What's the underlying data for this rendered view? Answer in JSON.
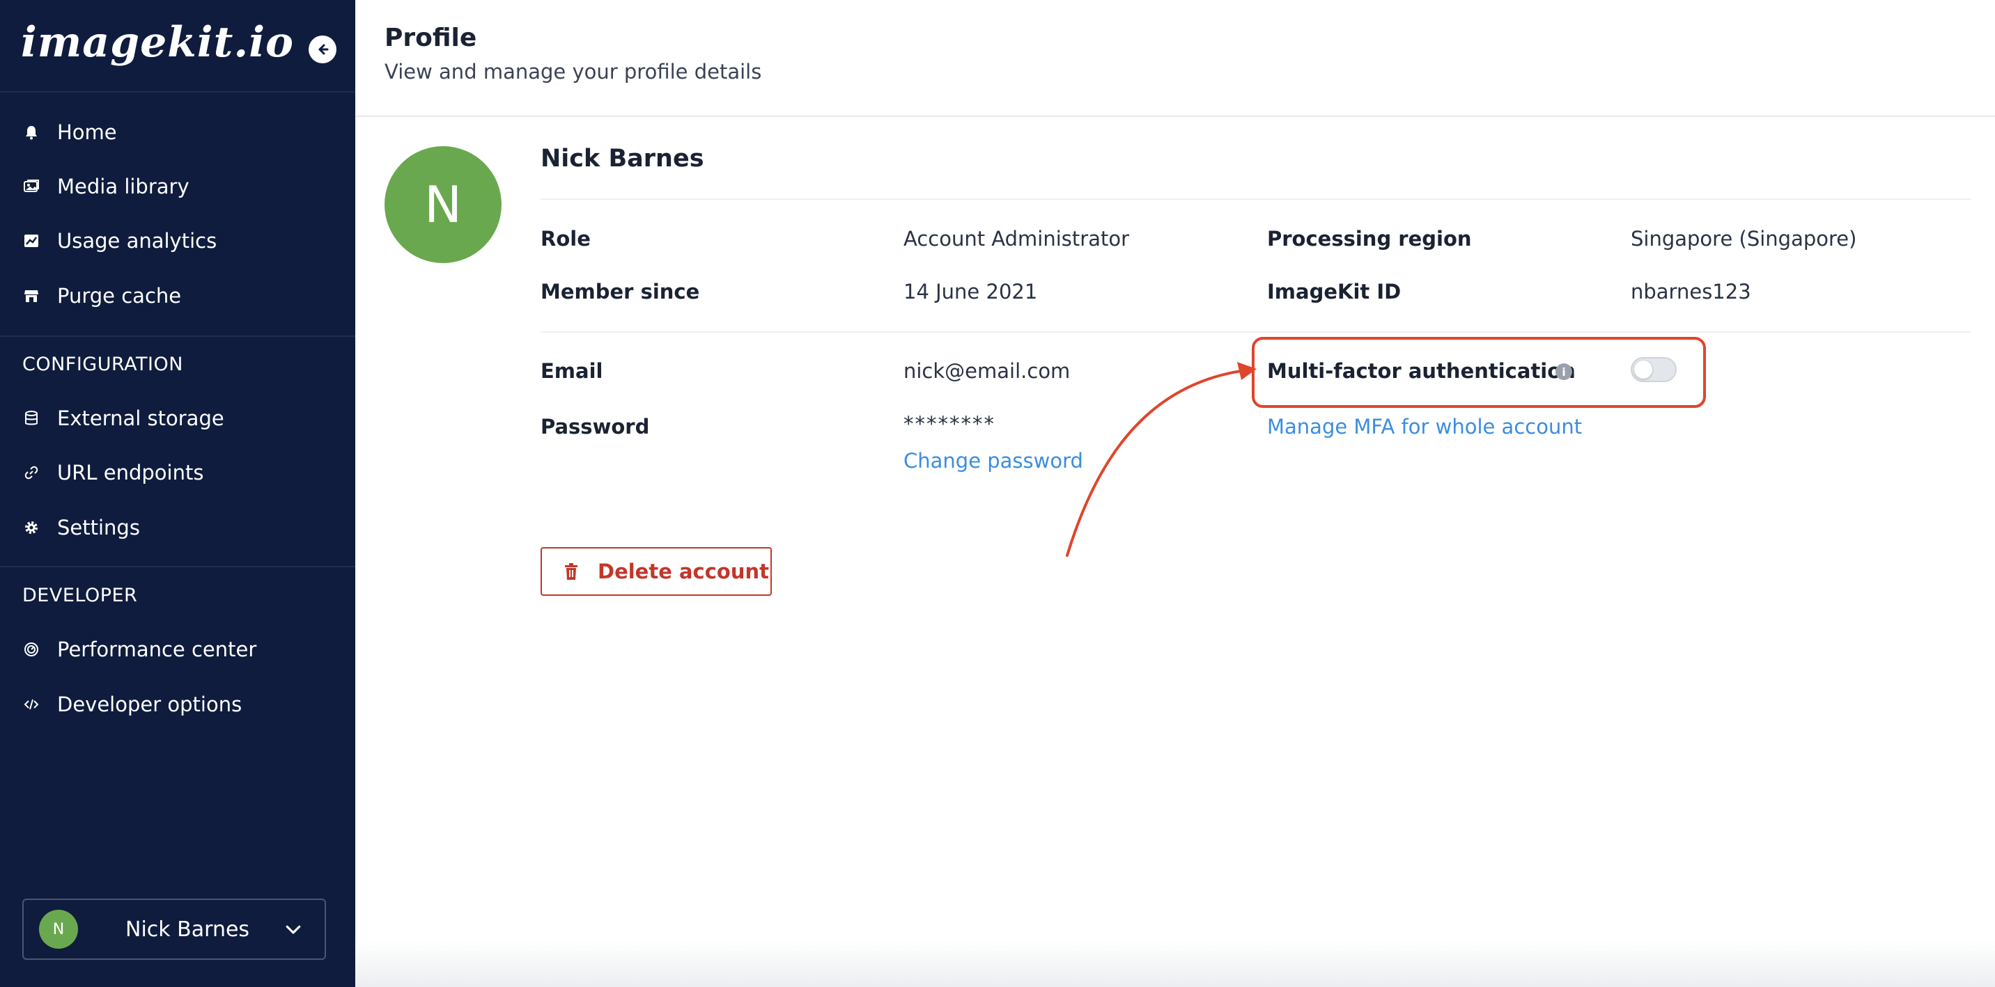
{
  "brand": {
    "logo_text": "imagekit.io"
  },
  "sidebar": {
    "items": [
      {
        "label": "Home",
        "icon": "bell-icon"
      },
      {
        "label": "Media library",
        "icon": "images-icon"
      },
      {
        "label": "Usage analytics",
        "icon": "chart-icon"
      },
      {
        "label": "Purge cache",
        "icon": "store-icon"
      }
    ],
    "configuration": {
      "title": "CONFIGURATION",
      "items": [
        {
          "label": "External storage",
          "icon": "database-icon"
        },
        {
          "label": "URL endpoints",
          "icon": "link-icon"
        },
        {
          "label": "Settings",
          "icon": "gear-icon"
        }
      ]
    },
    "developer": {
      "title": "DEVELOPER",
      "items": [
        {
          "label": "Performance center",
          "icon": "gauge-icon"
        },
        {
          "label": "Developer options",
          "icon": "code-icon"
        }
      ]
    },
    "user": {
      "initial": "N",
      "name": "Nick Barnes"
    }
  },
  "header": {
    "title": "Profile",
    "subtitle": "View and manage your profile details"
  },
  "profile": {
    "initial": "N",
    "name": "Nick Barnes",
    "role_label": "Role",
    "role_value": "Account Administrator",
    "region_label": "Processing region",
    "region_value": "Singapore (Singapore)",
    "member_label": "Member since",
    "member_value": "14 June 2021",
    "id_label": "ImageKit ID",
    "id_value": "nbarnes123",
    "email_label": "Email",
    "email_value": "nick@email.com",
    "password_label": "Password",
    "password_value": "********",
    "change_password": "Change password",
    "mfa_label": "Multi-factor authentication",
    "mfa_info": "i",
    "mfa_enabled": false,
    "manage_mfa": "Manage MFA for whole account",
    "delete_account": "Delete account"
  },
  "colors": {
    "sidebar_bg": "#0f1c3d",
    "avatar_green": "#6aa84f",
    "link_blue": "#3b8de0",
    "danger_red": "#c2372a",
    "highlight_red": "#e0452b"
  }
}
